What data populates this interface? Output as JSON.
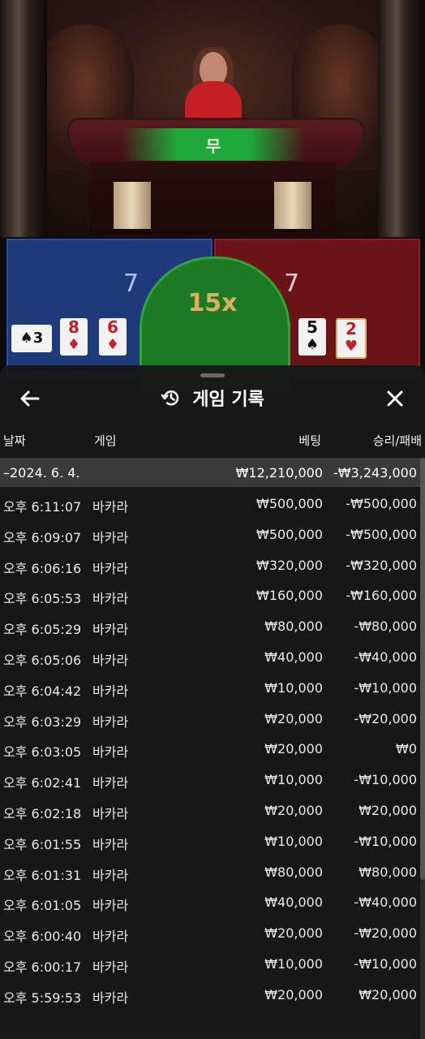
{
  "table": {
    "result_label": "무",
    "tie_multiplier": "15x"
  },
  "player": {
    "score": "7",
    "cards": [
      {
        "rank": "3",
        "suit": "♠"
      },
      {
        "rank": "8",
        "suit": "♦"
      },
      {
        "rank": "6",
        "suit": "♦"
      }
    ]
  },
  "banker": {
    "score": "7",
    "cards": [
      {
        "rank": "5",
        "suit": "♠"
      },
      {
        "rank": "2",
        "suit": "♥"
      }
    ]
  },
  "history": {
    "title": "게임 기록",
    "icons": {
      "back": "arrow-left-icon",
      "close": "close-icon",
      "title": "history-clock-icon"
    },
    "columns": {
      "date": "날짜",
      "game": "게임",
      "bet": "베팅",
      "win_loss": "승리/패배"
    },
    "date_group": {
      "date": "–2024. 6. 4.",
      "bet": "₩12,210,000",
      "win_loss": "-₩3,243,000"
    },
    "rows": [
      {
        "time": "오후 6:11:07",
        "game": "바카라",
        "bet": "₩500,000",
        "win_loss": "-₩500,000"
      },
      {
        "time": "오후 6:09:07",
        "game": "바카라",
        "bet": "₩500,000",
        "win_loss": "-₩500,000"
      },
      {
        "time": "오후 6:06:16",
        "game": "바카라",
        "bet": "₩320,000",
        "win_loss": "-₩320,000"
      },
      {
        "time": "오후 6:05:53",
        "game": "바카라",
        "bet": "₩160,000",
        "win_loss": "-₩160,000"
      },
      {
        "time": "오후 6:05:29",
        "game": "바카라",
        "bet": "₩80,000",
        "win_loss": "-₩80,000"
      },
      {
        "time": "오후 6:05:06",
        "game": "바카라",
        "bet": "₩40,000",
        "win_loss": "-₩40,000"
      },
      {
        "time": "오후 6:04:42",
        "game": "바카라",
        "bet": "₩10,000",
        "win_loss": "-₩10,000"
      },
      {
        "time": "오후 6:03:29",
        "game": "바카라",
        "bet": "₩20,000",
        "win_loss": "-₩20,000"
      },
      {
        "time": "오후 6:03:05",
        "game": "바카라",
        "bet": "₩20,000",
        "win_loss": "₩0"
      },
      {
        "time": "오후 6:02:41",
        "game": "바카라",
        "bet": "₩10,000",
        "win_loss": "-₩10,000"
      },
      {
        "time": "오후 6:02:18",
        "game": "바카라",
        "bet": "₩20,000",
        "win_loss": "₩20,000"
      },
      {
        "time": "오후 6:01:55",
        "game": "바카라",
        "bet": "₩10,000",
        "win_loss": "-₩10,000"
      },
      {
        "time": "오후 6:01:31",
        "game": "바카라",
        "bet": "₩80,000",
        "win_loss": "₩80,000"
      },
      {
        "time": "오후 6:01:05",
        "game": "바카라",
        "bet": "₩40,000",
        "win_loss": "-₩40,000"
      },
      {
        "time": "오후 6:00:40",
        "game": "바카라",
        "bet": "₩20,000",
        "win_loss": "-₩20,000"
      },
      {
        "time": "오후 6:00:17",
        "game": "바카라",
        "bet": "₩10,000",
        "win_loss": "-₩10,000"
      },
      {
        "time": "오후 5:59:53",
        "game": "바카라",
        "bet": "₩20,000",
        "win_loss": "₩20,000"
      }
    ]
  }
}
